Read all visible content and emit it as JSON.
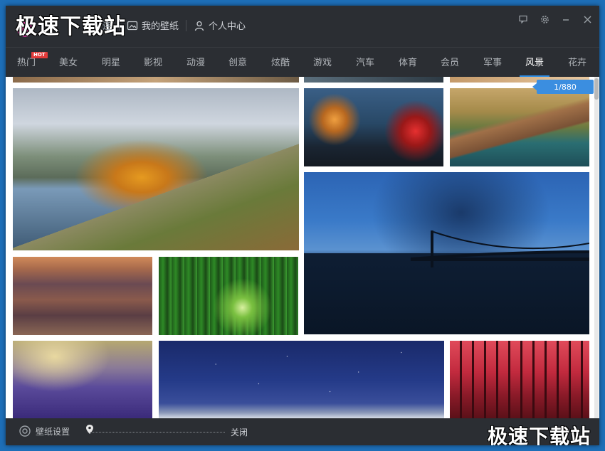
{
  "watermark": "极速下载站",
  "header": {
    "nav_partial": "连",
    "my_wallpaper": "我的壁纸",
    "user_center": "个人中心"
  },
  "tabs": [
    {
      "label": "热门",
      "badge": "HOT"
    },
    {
      "label": "美女"
    },
    {
      "label": "明星"
    },
    {
      "label": "影视"
    },
    {
      "label": "动漫"
    },
    {
      "label": "创意"
    },
    {
      "label": "炫酷"
    },
    {
      "label": "游戏"
    },
    {
      "label": "汽车"
    },
    {
      "label": "体育"
    },
    {
      "label": "会员"
    },
    {
      "label": "军事"
    },
    {
      "label": "风景",
      "active": true
    },
    {
      "label": "花卉"
    }
  ],
  "gallery": {
    "counter": "1/880"
  },
  "footer": {
    "settings_label": "壁纸设置",
    "close_label": "关闭"
  },
  "colors": {
    "accent": "#2f8de4",
    "hot_badge": "#e23a3a",
    "chrome": "#2b2e33"
  }
}
